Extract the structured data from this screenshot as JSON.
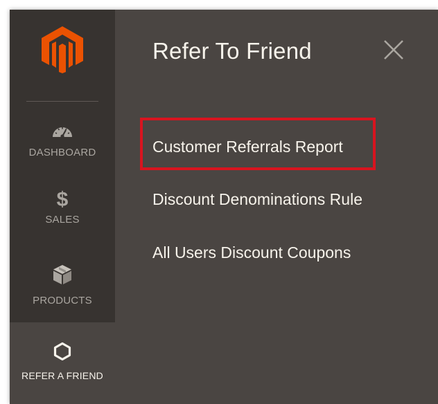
{
  "sidebar": {
    "logo_icon": "magento-logo-icon",
    "logo_color": "#eb5202",
    "items": [
      {
        "label": "DASHBOARD",
        "icon": "speedometer-icon"
      },
      {
        "label": "SALES",
        "icon": "dollar-icon",
        "icon_glyph": "$"
      },
      {
        "label": "PRODUCTS",
        "icon": "cube-icon"
      },
      {
        "label": "REFER A FRIEND",
        "icon": "hexagon-icon",
        "active": true
      }
    ]
  },
  "panel": {
    "title": "Refer To Friend",
    "close_icon": "close-icon",
    "links": [
      {
        "label": "Customer Referrals Report",
        "highlighted": true
      },
      {
        "label": "Discount Denominations Rule"
      },
      {
        "label": "All Users Discount Coupons"
      }
    ]
  },
  "colors": {
    "sidebar_bg": "#373330",
    "panel_bg": "#4a4542",
    "text": "#f7f3eb",
    "nav_text": "#aaa6a0",
    "highlight": "#d8141f"
  }
}
